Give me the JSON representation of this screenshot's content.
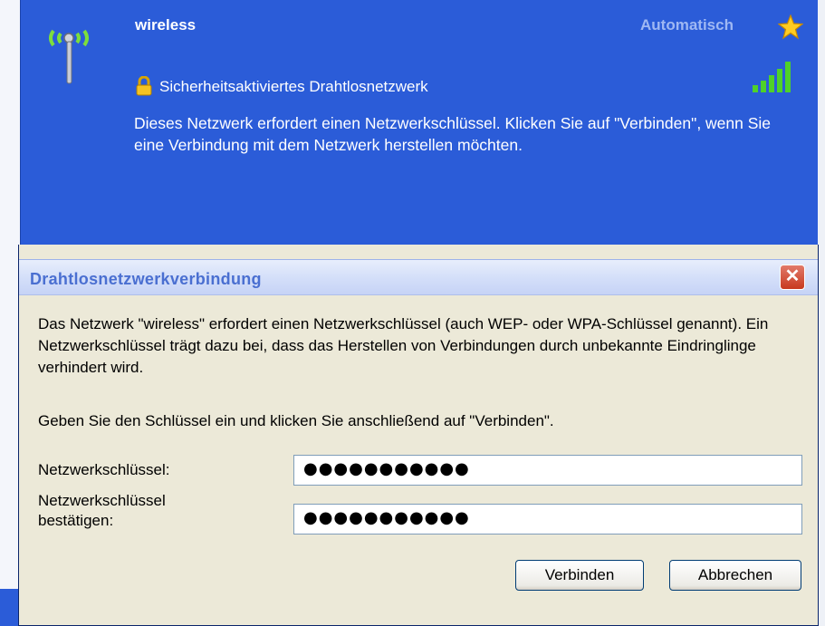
{
  "network": {
    "name": "wireless",
    "mode": "Automatisch",
    "security": "Sicherheitsaktiviertes Drahtlosnetzwerk",
    "description": "Dieses Netzwerk erfordert einen Netzwerkschlüssel. Klicken Sie auf \"Verbinden\", wenn Sie eine Verbindung mit dem Netzwerk herstellen möchten.",
    "icons": [
      "wireless-antenna-icon",
      "star-icon",
      "lock-icon",
      "signal-strength-icon"
    ]
  },
  "dialog": {
    "title": "Drahtlosnetzwerkverbindung",
    "paragraph1": "Das Netzwerk \"wireless\" erfordert einen Netzwerkschlüssel (auch WEP- oder WPA-Schlüssel genannt). Ein Netzwerkschlüssel trägt dazu bei, dass das Herstellen von Verbindungen durch unbekannte Eindringlinge verhindert wird.",
    "paragraph2": "Geben Sie den Schlüssel ein und klicken Sie anschließend auf \"Verbinden\".",
    "key_label": "Netzwerkschlüssel:",
    "confirm_label": "Netzwerkschlüssel bestätigen:",
    "key_value": "●●●●●●●●●●●",
    "confirm_value": "●●●●●●●●●●●",
    "connect_button": "Verbinden",
    "cancel_button": "Abbrechen",
    "close_glyph": "✕"
  },
  "colors": {
    "panel_blue": "#2b5cd8",
    "dialog_bg": "#ece9d8",
    "title_text": "#4a6fd1",
    "close_red": "#c8391f"
  }
}
